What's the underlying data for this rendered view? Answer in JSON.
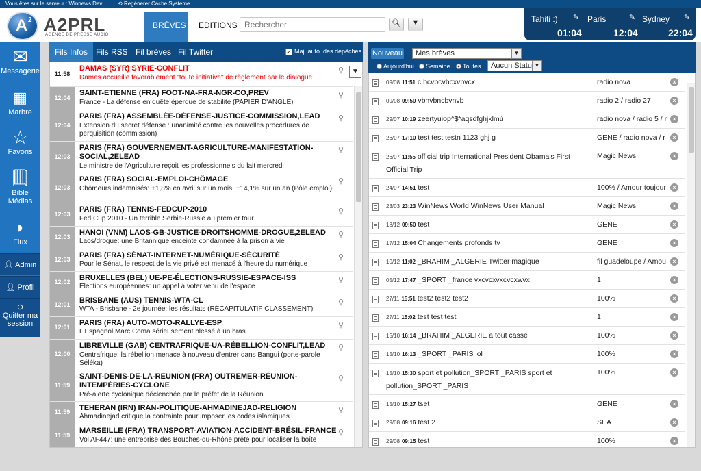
{
  "topbar": {
    "server_text": "Vous êtes sur le serveur : Winnews Dev",
    "regen_text": "Regénerer Cache Systeme"
  },
  "logo": {
    "text": "A2PRL",
    "subtitle": "AGENCE DE PRESSE AUDIO",
    "mark_letter": "A",
    "mark_sup": "2"
  },
  "nav": {
    "breves": "BRÈVES",
    "editions": "EDITIONS",
    "search_placeholder": "Rechercher"
  },
  "clocks": [
    {
      "city": "Tahiti :)",
      "time": "01:04"
    },
    {
      "city": "Paris",
      "time": "12:04"
    },
    {
      "city": "Sydney",
      "time": "22:04"
    }
  ],
  "sidebar": {
    "items": [
      {
        "label": "Messagerie",
        "icon": "envelope-icon"
      },
      {
        "label": "Marbre",
        "icon": "calendar-icon"
      },
      {
        "label": "Favoris",
        "icon": "star-icon"
      },
      {
        "label": "Bible Médias",
        "icon": "book-icon"
      },
      {
        "label": "Flux",
        "icon": "rss-icon"
      }
    ],
    "admin": "Admin",
    "profil": "Profil",
    "quit": "Quitter ma session"
  },
  "left_panel": {
    "tabs": [
      "Fils Infos",
      "Fils RSS",
      "Fil brèves",
      "Fil Twitter"
    ],
    "auto_label": "Maj. auto. des dépêches",
    "news": [
      {
        "time": "11:58",
        "title": "DAMAS (SYR) SYRIE-CONFLIT",
        "sub": "Damas accueille favorablement \"toute initiative\" de règlement par le dialogue",
        "red": true
      },
      {
        "time": "12:04",
        "title": "SAINT-ETIENNE (FRA) FOOT-NA-FRA-NGR-CO,PREV",
        "sub": "France - La défense en quête éperdue de stabilité (PAPIER D'ANGLE)"
      },
      {
        "time": "12:04",
        "title": "PARIS (FRA) ASSEMBLÉE-DÉFENSE-JUSTICE-COMMISSION,LEAD",
        "sub": "Extension du secret défense : unanimité contre les nouvelles procédures de perquisition (commission)"
      },
      {
        "time": "12:03",
        "title": "PARIS (FRA) GOUVERNEMENT-AGRICULTURE-MANIFESTATION-SOCIAL,2ELEAD",
        "sub": "Le ministre de l'Agriculture reçoit les professionnels du lait mercredi"
      },
      {
        "time": "12:03",
        "title": "PARIS (FRA) SOCIAL-EMPLOI-CHÔMAGE",
        "sub": "Chômeurs indemnisés: +1,8% en avril sur un mois, +14,1% sur un an (Pôle emploi)"
      },
      {
        "time": "12:03",
        "title": "PARIS (FRA) TENNIS-FEDCUP-2010",
        "sub": "Fed Cup 2010 - Un terrible Serbie-Russie au premier tour"
      },
      {
        "time": "12:03",
        "title": "HANOI (VNM) LAOS-GB-JUSTICE-DROITSHOMME-DROGUE,2ELEAD",
        "sub": "Laos/drogue: une Britannique enceinte condamnée à la prison à vie"
      },
      {
        "time": "12:03",
        "title": "PARIS (FRA) SÉNAT-INTERNET-NUMÉRIQUE-SÉCURITÉ",
        "sub": "Pour le Sénat, le respect de la vie privé est menacé à l'heure du numérique"
      },
      {
        "time": "12:02",
        "title": "BRUXELLES (BEL) UE-PE-ÉLECTIONS-RUSSIE-ESPACE-ISS",
        "sub": "Elections européennes: un appel à voter venu de l'espace"
      },
      {
        "time": "12:01",
        "title": "BRISBANE (AUS) TENNIS-WTA-CL",
        "sub": "WTA - Brisbane - 2e journée: les résultats (RÉCAPITULATIF CLASSEMENT)"
      },
      {
        "time": "12:01",
        "title": "PARIS (FRA) AUTO-MOTO-RALLYE-ESP",
        "sub": "L'Espagnol Marc Coma sérieusement blessé à un bras"
      },
      {
        "time": "12:00",
        "title": "LIBREVILLE (GAB) CENTRAFRIQUE-UA-RÉBELLION-CONFLIT,LEAD",
        "sub": "Centrafrique: la rébellion menace à nouveau d'entrer dans Bangui (porte-parole Séléka)"
      },
      {
        "time": "11:59",
        "title": "SAINT-DENIS-DE-LA-REUNION (FRA) OUTREMER-RÉUNION-INTEMPÉRIES-CYCLONE",
        "sub": "Pré-alerte cyclonique déclenchée par le préfet de la Réunion"
      },
      {
        "time": "11:59",
        "title": "TEHERAN (IRN) IRAN-POLITIQUE-AHMADINEJAD-RELIGION",
        "sub": "Ahmadinejad critique la contrainte pour imposer les codes islamiques"
      },
      {
        "time": "11:59",
        "title": "MARSEILLE (FRA) TRANSPORT-AVIATION-ACCIDENT-BRÉSIL-FRANCE",
        "sub": "Vol AF447: une entreprise des Bouches-du-Rhône prête pour localiser la boîte"
      }
    ]
  },
  "right_panel": {
    "nouveau": "Nouveau",
    "select_label": "Mes brèves",
    "radios": [
      "Aujourd'hui",
      "Semaine",
      "Toutes"
    ],
    "status_select": "Aucun Statut",
    "messages": [
      {
        "date": "09/08",
        "time": "11:51",
        "text": "c bcvbcvbcxvbvcx",
        "dest": "radio nova"
      },
      {
        "date": "09/08",
        "time": "09:50",
        "text": "vbnvbncbvnvb",
        "dest": "radio 2 / radio 27"
      },
      {
        "date": "29/07",
        "time": "10:19",
        "text": "zeertyuiop^$*aqsdfghjklmù",
        "dest": "radio nova / radio 5 / r"
      },
      {
        "date": "26/07",
        "time": "17:10",
        "text": "test test testn 1123 ghj g",
        "dest": "GENE / radio nova / r"
      },
      {
        "date": "26/07",
        "time": "11:55",
        "text": "official trip International President Obama's First Official Trip",
        "dest": "Magic News"
      },
      {
        "date": "24/07",
        "time": "14:51",
        "text": "test",
        "dest": "100% / Amour toujour"
      },
      {
        "date": "23/03",
        "time": "23:23",
        "text": "WinNews World WinNews User Manual",
        "dest": "Magic News"
      },
      {
        "date": "18/12",
        "time": "09:50",
        "text": "test",
        "dest": "GENE"
      },
      {
        "date": "17/12",
        "time": "15:04",
        "text": "Changements profonds tv",
        "dest": "GENE"
      },
      {
        "date": "10/12",
        "time": "11:02",
        "text": "_BRAHIM _ALGERIE Twitter magique",
        "dest": "fil guadeloupe / Amou"
      },
      {
        "date": "05/12",
        "time": "17:47",
        "text": "_SPORT _france vxcvcxvxcvcxwvx",
        "dest": "1"
      },
      {
        "date": "27/11",
        "time": "15:51",
        "text": "test2 test2 test2",
        "dest": "100%"
      },
      {
        "date": "27/11",
        "time": "15:02",
        "text": "test test test",
        "dest": "1"
      },
      {
        "date": "15/10",
        "time": "16:14",
        "text": "_BRAHIM _ALGERIE a tout cassé",
        "dest": "100%"
      },
      {
        "date": "15/10",
        "time": "16:13",
        "text": "_SPORT _PARIS lol",
        "dest": "100%"
      },
      {
        "date": "15/10",
        "time": "15:30",
        "text": "sport et pollution_SPORT _PARIS sport et pollution_SPORT _PARIS",
        "dest": "100%"
      },
      {
        "date": "15/10",
        "time": "15:27",
        "text": "tset",
        "dest": "GENE"
      },
      {
        "date": "29/08",
        "time": "09:16",
        "text": "test 2",
        "dest": "SEA"
      },
      {
        "date": "29/08",
        "time": "09:15",
        "text": "test",
        "dest": "100%"
      }
    ]
  }
}
